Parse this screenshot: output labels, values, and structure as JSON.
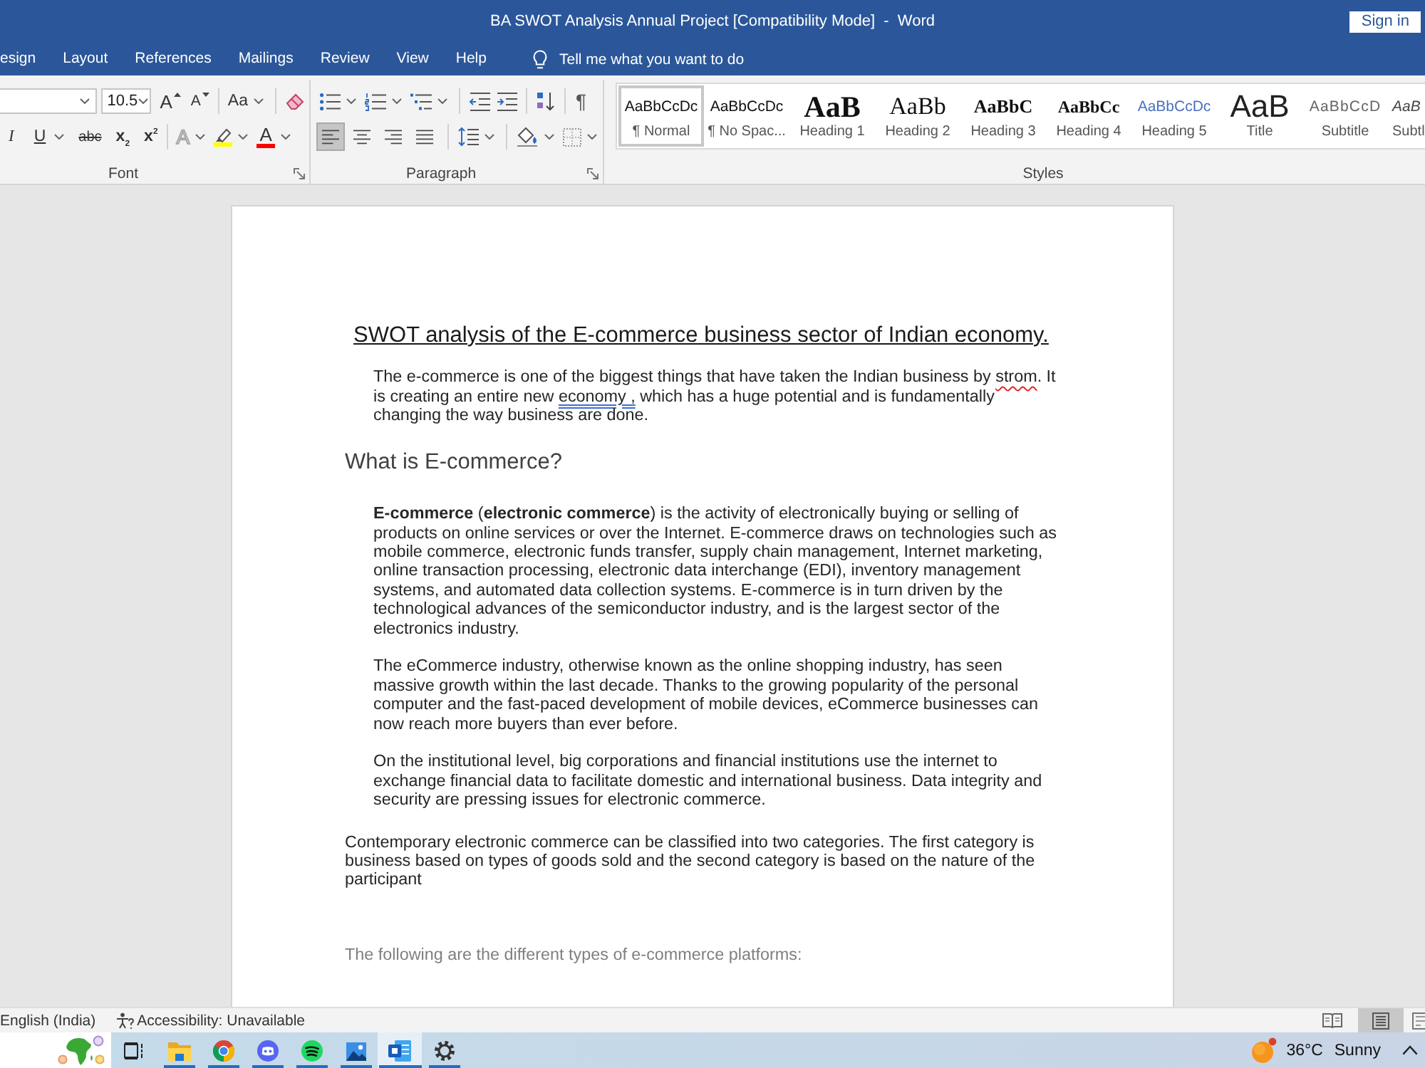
{
  "window": {
    "title": "BA SWOT Analysis Annual Project [Compatibility Mode]  -  Word",
    "sign_in": "Sign in"
  },
  "tabs": [
    {
      "label": "esign",
      "selected": false
    },
    {
      "label": "Layout",
      "selected": false
    },
    {
      "label": "References",
      "selected": false
    },
    {
      "label": "Mailings",
      "selected": false
    },
    {
      "label": "Review",
      "selected": false
    },
    {
      "label": "View",
      "selected": false
    },
    {
      "label": "Help",
      "selected": false
    }
  ],
  "search": {
    "placeholder": "Tell me what you want to do"
  },
  "ribbon": {
    "font": {
      "label": "Font",
      "size": "10.5",
      "grow": "A",
      "shrink": "A",
      "change_case": "Aa",
      "styles": [
        {
          "text": "I",
          "dropdown": false
        },
        {
          "text": "U",
          "dropdown": true
        },
        {
          "text": "abc",
          "dropdown": false
        },
        {
          "text": "x$_{2}$",
          "dropdown": false
        },
        {
          "text": "x$^{2}$",
          "dropdown": false
        }
      ],
      "effects": "A",
      "highlight": {
        "color": "#ffff00"
      },
      "font_color": {
        "text": "A",
        "color": "#ff0000"
      }
    },
    "paragraph": {
      "label": "Paragraph",
      "marks": "¶",
      "alignments": [
        {
          "selected": true
        },
        {
          "selected": false
        },
        {
          "selected": false
        },
        {
          "selected": false
        }
      ]
    },
    "styles": {
      "label": "Styles",
      "items": [
        {
          "preview": "AaBbCcDc",
          "label": "¶ Normal",
          "kind": "normal",
          "selected": true
        },
        {
          "preview": "AaBbCcDc",
          "label": "¶ No Spac...",
          "kind": "nospacing",
          "selected": false
        },
        {
          "preview": "AaB",
          "label": "Heading 1",
          "kind": "heading1",
          "selected": false
        },
        {
          "preview": "AaBb",
          "label": "Heading 2",
          "kind": "heading2",
          "selected": false
        },
        {
          "preview": "AaBbC",
          "label": "Heading 3",
          "kind": "heading3",
          "selected": false
        },
        {
          "preview": "AaBbCc",
          "label": "Heading 4",
          "kind": "heading4",
          "selected": false
        },
        {
          "preview": "AaBbCcDc",
          "label": "Heading 5",
          "kind": "heading5",
          "selected": false
        },
        {
          "preview": "AaB",
          "label": "Title",
          "kind": "title",
          "selected": false
        },
        {
          "preview": "AaBbCcD",
          "label": "Subtitle",
          "kind": "subtitle",
          "selected": false
        },
        {
          "preview": "AaB",
          "label": "Subtl",
          "kind": "subtle",
          "selected": false
        }
      ]
    }
  },
  "document": {
    "title": "SWOT analysis of the E-commerce business sector of Indian economy.",
    "blocks": [
      {
        "kind": "indented",
        "segments": [
          {
            "kind": "plain",
            "text": "The e-commerce is one of the biggest things that have taken the Indian business by "
          },
          {
            "kind": "spelling",
            "text": "strom"
          },
          {
            "kind": "plain",
            "text": ". It is creating an entire new "
          },
          {
            "kind": "grammar",
            "text": "economy ,"
          },
          {
            "kind": "plain",
            "text": " which has a huge potential and is fundamentally changing the way business are done."
          }
        ]
      },
      {
        "kind": "heading",
        "text": "What is E-commerce?"
      },
      {
        "kind": "indented",
        "text": "**E-commerce** (**electronic commerce**) is the activity of electronically buying or selling of products on online services or over the Internet. E-commerce draws on technologies such as mobile commerce, electronic funds transfer, supply chain management, Internet marketing, online transaction processing, electronic data interchange (EDI), inventory management systems, and automated data collection systems. E-commerce is in turn driven by the technological advances of the semiconductor industry, and is the largest sector of the electronics industry."
      },
      {
        "kind": "indented",
        "text": "The eCommerce industry, otherwise known as the online shopping industry, has seen massive growth within the last decade. Thanks to the growing popularity of the personal computer and the fast-paced development of mobile devices, eCommerce businesses can now reach more buyers than ever before."
      },
      {
        "kind": "indented",
        "text": "On the institutional level, big corporations and financial institutions use the internet to exchange financial data to facilitate domestic and international business. Data integrity and security are pressing issues for electronic commerce."
      },
      {
        "kind": "plain",
        "text": "Contemporary electronic commerce can be classified into two categories. The first category is business based on types of goods sold and the second category is based on the nature of the participant"
      },
      {
        "kind": "muted",
        "text": "The following are the different types of e-commerce platforms:"
      }
    ]
  },
  "status_bar": {
    "language": "English (India)",
    "accessibility": "Accessibility: Unavailable",
    "views": [
      {
        "selected": false
      },
      {
        "selected": true
      },
      {
        "selected": false
      }
    ]
  },
  "taskbar": {
    "apps": [
      {
        "running": true,
        "active": false
      },
      {
        "running": true,
        "active": false
      },
      {
        "running": true,
        "active": false
      },
      {
        "running": true,
        "active": false
      },
      {
        "running": true,
        "active": false
      },
      {
        "running": true,
        "active": true
      },
      {
        "running": true,
        "active": false
      }
    ],
    "weather": {
      "temperature": "36°C",
      "condition": "Sunny"
    }
  }
}
